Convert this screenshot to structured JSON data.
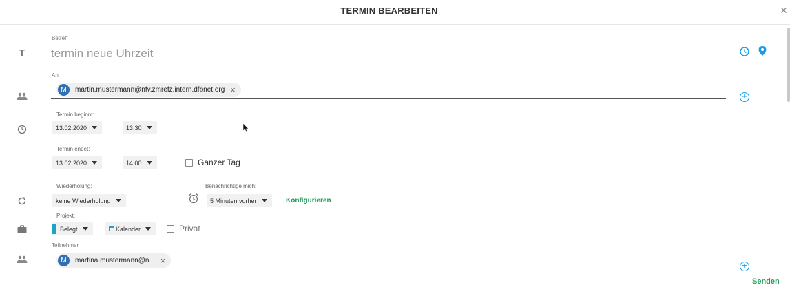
{
  "dialog": {
    "title": "TERMIN BEARBEITEN",
    "close_glyph": "×"
  },
  "subject": {
    "label": "Betreff",
    "value": "termin neue Uhrzeit"
  },
  "to": {
    "label": "An",
    "recipients": [
      {
        "initial": "M",
        "email": "martin.mustermann@nfv.zmrefz.intern.dfbnet.org"
      }
    ]
  },
  "start": {
    "label": "Termin beginnt:",
    "date": "13.02.2020",
    "time": "13:30"
  },
  "end": {
    "label": "Termin endet:",
    "date": "13.02.2020",
    "time": "14:00",
    "all_day_label": "Ganzer Tag",
    "all_day_checked": false
  },
  "repeat": {
    "label": "Wiederholung:",
    "value": "keine Wiederholung"
  },
  "notify": {
    "label": "Benachrichtige mich:",
    "value": "5 Minuten vorher",
    "configure_label": "Konfigurieren"
  },
  "project": {
    "label": "Projekt:",
    "status_value": "Belegt",
    "calendar_value": "Kalender",
    "private_label": "Privat",
    "private_checked": false
  },
  "participants": {
    "label": "Teilnehmer",
    "items": [
      {
        "initial": "M",
        "name": "martina.mustermann@n..."
      }
    ]
  },
  "footer": {
    "send_label": "Senden"
  },
  "icons": {
    "subject": "text-icon",
    "to": "people-icon",
    "time": "clock-icon",
    "repeat": "repeat-icon",
    "project": "briefcase-icon",
    "participants": "people-icon",
    "alarm": "alarm-clock-icon",
    "timezone": "clock-icon",
    "location": "location-pin-icon",
    "add": "plus-circle-icon"
  },
  "colors": {
    "accent_blue": "#1a9ce6",
    "green": "#1e9e5a",
    "avatar": "#2f6fb3",
    "status_bar": "#1ea3c8"
  }
}
